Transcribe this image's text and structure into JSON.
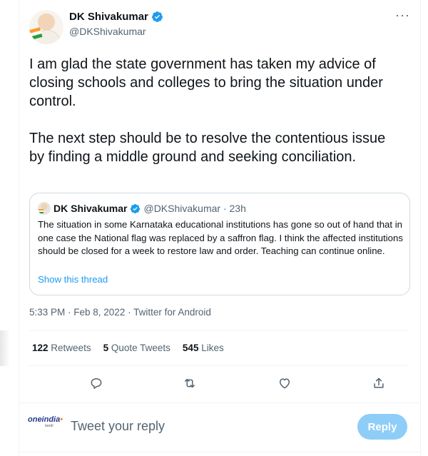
{
  "tweet": {
    "author_name": "DK Shivakumar",
    "author_handle": "@DKShivakumar",
    "more_label": "···",
    "paragraphs": [
      "I am glad the state government has taken my advice of closing schools and colleges to bring the situation under control.",
      "The next step should be to resolve the contentious issue by finding a middle ground and seeking conciliation."
    ],
    "timestamp": "5:33 PM · Feb 8, 2022 · Twitter for Android"
  },
  "quote": {
    "author_name": "DK Shivakumar",
    "meta": "@DKShivakumar · 23h",
    "text": "The situation in some Karnataka educational institutions has gone so out of hand that in one case the National flag was replaced by a saffron flag. I think the affected institutions should be closed for a week to restore law and order. Teaching can continue online.",
    "show_thread": "Show this thread"
  },
  "stats": {
    "retweets_count": "122",
    "retweets_label": "Retweets",
    "quotes_count": "5",
    "quotes_label": "Quote Tweets",
    "likes_count": "545",
    "likes_label": "Likes"
  },
  "actions": {
    "icons": [
      "reply-icon",
      "retweet-icon",
      "like-icon",
      "share-icon"
    ]
  },
  "reply": {
    "avatar_text": "oneindia",
    "avatar_sub": "tamil",
    "placeholder": "Tweet your reply",
    "button_label": "Reply"
  },
  "colors": {
    "accent": "#1d9bf0",
    "reply_button_disabled": "#8ecdf8",
    "secondary_text": "#536471",
    "primary_text": "#0f1419"
  }
}
